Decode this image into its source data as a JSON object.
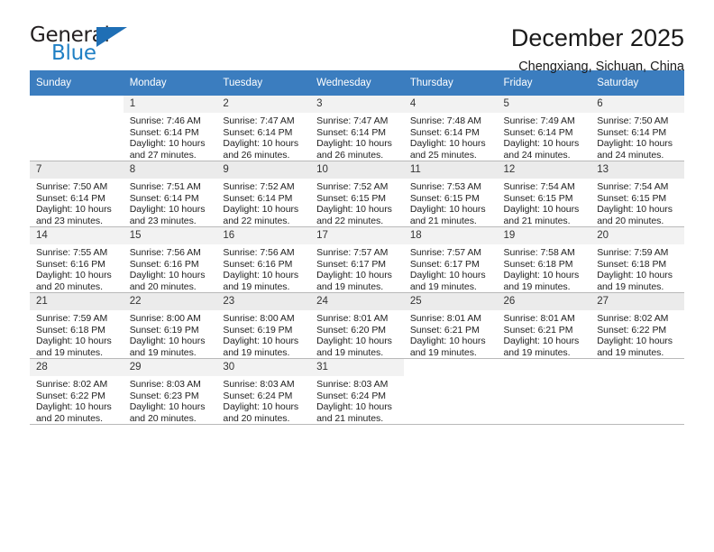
{
  "brand": {
    "name_top": "General",
    "name_bottom": "Blue",
    "triangle_color": "#1f6fb5",
    "blue_color": "#1f7fc4"
  },
  "header": {
    "title": "December 2025",
    "location": "Chengxiang, Sichuan, China"
  },
  "calendar": {
    "header_bg": "#3b7dbf",
    "weekdays": [
      "Sunday",
      "Monday",
      "Tuesday",
      "Wednesday",
      "Thursday",
      "Friday",
      "Saturday"
    ],
    "weeks": [
      [
        {
          "day": "",
          "sunrise": "",
          "sunset": "",
          "daylight": ""
        },
        {
          "day": "1",
          "sunrise": "Sunrise: 7:46 AM",
          "sunset": "Sunset: 6:14 PM",
          "daylight": "Daylight: 10 hours and 27 minutes."
        },
        {
          "day": "2",
          "sunrise": "Sunrise: 7:47 AM",
          "sunset": "Sunset: 6:14 PM",
          "daylight": "Daylight: 10 hours and 26 minutes."
        },
        {
          "day": "3",
          "sunrise": "Sunrise: 7:47 AM",
          "sunset": "Sunset: 6:14 PM",
          "daylight": "Daylight: 10 hours and 26 minutes."
        },
        {
          "day": "4",
          "sunrise": "Sunrise: 7:48 AM",
          "sunset": "Sunset: 6:14 PM",
          "daylight": "Daylight: 10 hours and 25 minutes."
        },
        {
          "day": "5",
          "sunrise": "Sunrise: 7:49 AM",
          "sunset": "Sunset: 6:14 PM",
          "daylight": "Daylight: 10 hours and 24 minutes."
        },
        {
          "day": "6",
          "sunrise": "Sunrise: 7:50 AM",
          "sunset": "Sunset: 6:14 PM",
          "daylight": "Daylight: 10 hours and 24 minutes."
        }
      ],
      [
        {
          "day": "7",
          "sunrise": "Sunrise: 7:50 AM",
          "sunset": "Sunset: 6:14 PM",
          "daylight": "Daylight: 10 hours and 23 minutes."
        },
        {
          "day": "8",
          "sunrise": "Sunrise: 7:51 AM",
          "sunset": "Sunset: 6:14 PM",
          "daylight": "Daylight: 10 hours and 23 minutes."
        },
        {
          "day": "9",
          "sunrise": "Sunrise: 7:52 AM",
          "sunset": "Sunset: 6:14 PM",
          "daylight": "Daylight: 10 hours and 22 minutes."
        },
        {
          "day": "10",
          "sunrise": "Sunrise: 7:52 AM",
          "sunset": "Sunset: 6:15 PM",
          "daylight": "Daylight: 10 hours and 22 minutes."
        },
        {
          "day": "11",
          "sunrise": "Sunrise: 7:53 AM",
          "sunset": "Sunset: 6:15 PM",
          "daylight": "Daylight: 10 hours and 21 minutes."
        },
        {
          "day": "12",
          "sunrise": "Sunrise: 7:54 AM",
          "sunset": "Sunset: 6:15 PM",
          "daylight": "Daylight: 10 hours and 21 minutes."
        },
        {
          "day": "13",
          "sunrise": "Sunrise: 7:54 AM",
          "sunset": "Sunset: 6:15 PM",
          "daylight": "Daylight: 10 hours and 20 minutes."
        }
      ],
      [
        {
          "day": "14",
          "sunrise": "Sunrise: 7:55 AM",
          "sunset": "Sunset: 6:16 PM",
          "daylight": "Daylight: 10 hours and 20 minutes."
        },
        {
          "day": "15",
          "sunrise": "Sunrise: 7:56 AM",
          "sunset": "Sunset: 6:16 PM",
          "daylight": "Daylight: 10 hours and 20 minutes."
        },
        {
          "day": "16",
          "sunrise": "Sunrise: 7:56 AM",
          "sunset": "Sunset: 6:16 PM",
          "daylight": "Daylight: 10 hours and 19 minutes."
        },
        {
          "day": "17",
          "sunrise": "Sunrise: 7:57 AM",
          "sunset": "Sunset: 6:17 PM",
          "daylight": "Daylight: 10 hours and 19 minutes."
        },
        {
          "day": "18",
          "sunrise": "Sunrise: 7:57 AM",
          "sunset": "Sunset: 6:17 PM",
          "daylight": "Daylight: 10 hours and 19 minutes."
        },
        {
          "day": "19",
          "sunrise": "Sunrise: 7:58 AM",
          "sunset": "Sunset: 6:18 PM",
          "daylight": "Daylight: 10 hours and 19 minutes."
        },
        {
          "day": "20",
          "sunrise": "Sunrise: 7:59 AM",
          "sunset": "Sunset: 6:18 PM",
          "daylight": "Daylight: 10 hours and 19 minutes."
        }
      ],
      [
        {
          "day": "21",
          "sunrise": "Sunrise: 7:59 AM",
          "sunset": "Sunset: 6:18 PM",
          "daylight": "Daylight: 10 hours and 19 minutes."
        },
        {
          "day": "22",
          "sunrise": "Sunrise: 8:00 AM",
          "sunset": "Sunset: 6:19 PM",
          "daylight": "Daylight: 10 hours and 19 minutes."
        },
        {
          "day": "23",
          "sunrise": "Sunrise: 8:00 AM",
          "sunset": "Sunset: 6:19 PM",
          "daylight": "Daylight: 10 hours and 19 minutes."
        },
        {
          "day": "24",
          "sunrise": "Sunrise: 8:01 AM",
          "sunset": "Sunset: 6:20 PM",
          "daylight": "Daylight: 10 hours and 19 minutes."
        },
        {
          "day": "25",
          "sunrise": "Sunrise: 8:01 AM",
          "sunset": "Sunset: 6:21 PM",
          "daylight": "Daylight: 10 hours and 19 minutes."
        },
        {
          "day": "26",
          "sunrise": "Sunrise: 8:01 AM",
          "sunset": "Sunset: 6:21 PM",
          "daylight": "Daylight: 10 hours and 19 minutes."
        },
        {
          "day": "27",
          "sunrise": "Sunrise: 8:02 AM",
          "sunset": "Sunset: 6:22 PM",
          "daylight": "Daylight: 10 hours and 19 minutes."
        }
      ],
      [
        {
          "day": "28",
          "sunrise": "Sunrise: 8:02 AM",
          "sunset": "Sunset: 6:22 PM",
          "daylight": "Daylight: 10 hours and 20 minutes."
        },
        {
          "day": "29",
          "sunrise": "Sunrise: 8:03 AM",
          "sunset": "Sunset: 6:23 PM",
          "daylight": "Daylight: 10 hours and 20 minutes."
        },
        {
          "day": "30",
          "sunrise": "Sunrise: 8:03 AM",
          "sunset": "Sunset: 6:24 PM",
          "daylight": "Daylight: 10 hours and 20 minutes."
        },
        {
          "day": "31",
          "sunrise": "Sunrise: 8:03 AM",
          "sunset": "Sunset: 6:24 PM",
          "daylight": "Daylight: 10 hours and 21 minutes."
        },
        {
          "day": "",
          "sunrise": "",
          "sunset": "",
          "daylight": ""
        },
        {
          "day": "",
          "sunrise": "",
          "sunset": "",
          "daylight": ""
        },
        {
          "day": "",
          "sunrise": "",
          "sunset": "",
          "daylight": ""
        }
      ]
    ]
  }
}
